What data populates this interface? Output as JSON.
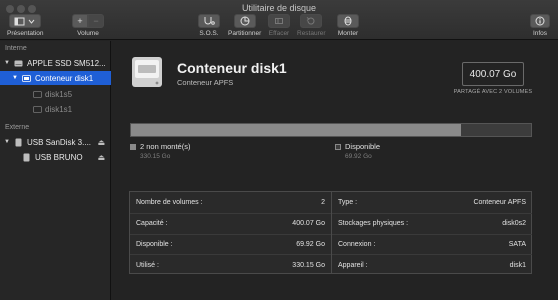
{
  "window": {
    "title": "Utilitaire de disque"
  },
  "toolbar": {
    "presentation_label": "Présentation",
    "volume_label": "Volume",
    "volume_add": "+",
    "volume_remove": "−",
    "sos_label": "S.O.S.",
    "partition_label": "Partitionner",
    "erase_label": "Effacer",
    "restore_label": "Restaurer",
    "mount_label": "Monter",
    "info_label": "Infos"
  },
  "sidebar": {
    "internal_header": "Interne",
    "external_header": "Externe",
    "items": [
      {
        "label": "APPLE SSD SM512...",
        "level": 0
      },
      {
        "label": "Conteneur disk1",
        "level": 1,
        "selected": true
      },
      {
        "label": "disk1s5",
        "level": 2
      },
      {
        "label": "disk1s1",
        "level": 2
      },
      {
        "label": "USB SanDisk 3....",
        "level": 0
      },
      {
        "label": "USB BRUNO",
        "level": 1
      }
    ]
  },
  "main": {
    "title": "Conteneur disk1",
    "subtitle": "Conteneur APFS",
    "capacity": "400.07 Go",
    "capacity_caption": "PARTAGÉ AVEC 2 VOLUMES",
    "usage_fraction": 0.8252,
    "legend": [
      {
        "label": "2 non monté(s)",
        "value": "330.15 Go",
        "color": "#8a8a8a"
      },
      {
        "label": "Disponible",
        "value": "69.92 Go",
        "color": "#3c3c3c"
      }
    ],
    "info_left": [
      {
        "key": "Nombre de volumes :",
        "value": "2"
      },
      {
        "key": "Capacité :",
        "value": "400.07 Go"
      },
      {
        "key": "Disponible :",
        "value": "69.92 Go"
      },
      {
        "key": "Utilisé :",
        "value": "330.15 Go"
      }
    ],
    "info_right": [
      {
        "key": "Type :",
        "value": "Conteneur APFS"
      },
      {
        "key": "Stockages physiques :",
        "value": "disk0s2"
      },
      {
        "key": "Connexion :",
        "value": "SATA"
      },
      {
        "key": "Appareil :",
        "value": "disk1"
      }
    ]
  }
}
